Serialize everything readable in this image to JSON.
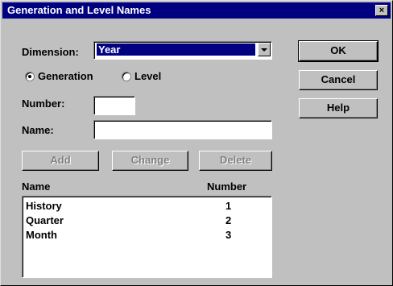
{
  "window": {
    "title": "Generation and Level Names",
    "close_label": "×"
  },
  "dimension": {
    "label": "Dimension:",
    "value": "Year"
  },
  "mode": {
    "generation_label": "Generation",
    "level_label": "Level",
    "selected": "Generation"
  },
  "number_field": {
    "label": "Number:",
    "value": ""
  },
  "name_field": {
    "label": "Name:",
    "value": ""
  },
  "actions": {
    "add": "Add",
    "change": "Change",
    "delete": "Delete"
  },
  "side_buttons": {
    "ok": "OK",
    "cancel": "Cancel",
    "help": "Help"
  },
  "list": {
    "col_name": "Name",
    "col_number": "Number",
    "rows": [
      {
        "name": "History",
        "number": "1"
      },
      {
        "name": "Quarter",
        "number": "2"
      },
      {
        "name": "Month",
        "number": "3"
      }
    ]
  }
}
